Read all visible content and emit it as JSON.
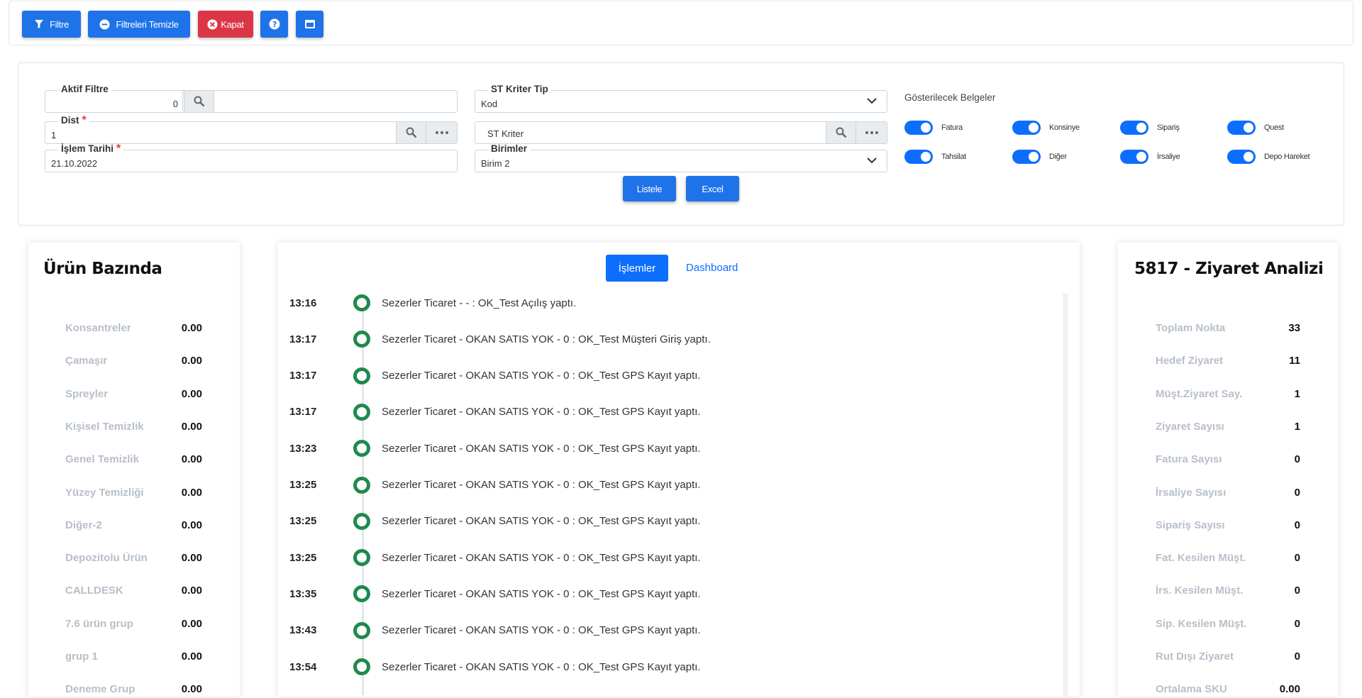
{
  "toolbar": {
    "filter_label": "Filtre",
    "clear_label": "Filtreleri Temizle",
    "close_label": "Kapat"
  },
  "filters": {
    "aktif_filtre": {
      "label": "Aktif Filtre",
      "value": "0"
    },
    "dist": {
      "label": "Dist",
      "value": "1"
    },
    "islem_tarihi": {
      "label": "İşlem Tarihi",
      "value": "21.10.2022"
    },
    "st_kriter_tip": {
      "label": "ST Kriter Tip",
      "value": "Kod"
    },
    "st_kriter": {
      "placeholder": "ST Kriter"
    },
    "birimler": {
      "label": "Birimler",
      "value": "Birim 2"
    },
    "required_mark": "*"
  },
  "documents": {
    "title": "Gösterilecek Belgeler",
    "toggles": [
      {
        "label": "Fatura",
        "on": true
      },
      {
        "label": "Konsinye",
        "on": true
      },
      {
        "label": "Sipariş",
        "on": true
      },
      {
        "label": "Quest",
        "on": true
      },
      {
        "label": "Tahsilat",
        "on": true
      },
      {
        "label": "Diğer",
        "on": true
      },
      {
        "label": "İrsaliye",
        "on": true
      },
      {
        "label": "Depo Hareket",
        "on": true
      }
    ]
  },
  "actions": {
    "list_label": "Listele",
    "excel_label": "Excel"
  },
  "product_card": {
    "title": "Ürün Bazında",
    "rows": [
      {
        "name": "Konsantreler",
        "value": "0.00"
      },
      {
        "name": "Çamaşır",
        "value": "0.00"
      },
      {
        "name": "Spreyler",
        "value": "0.00"
      },
      {
        "name": "Kişisel Temizlik",
        "value": "0.00"
      },
      {
        "name": "Genel Temizlik",
        "value": "0.00"
      },
      {
        "name": "Yüzey Temizliği",
        "value": "0.00"
      },
      {
        "name": "Diğer-2",
        "value": "0.00"
      },
      {
        "name": "Depozitolu Ürün",
        "value": "0.00"
      },
      {
        "name": "CALLDESK",
        "value": "0.00"
      },
      {
        "name": "7.6 ürün grup",
        "value": "0.00"
      },
      {
        "name": "grup 1",
        "value": "0.00"
      },
      {
        "name": "Deneme Grup",
        "value": "0.00"
      }
    ]
  },
  "timeline": {
    "tab_active": "İşlemler",
    "tab_other": "Dashboard",
    "events": [
      {
        "time": "13:16",
        "text": "Sezerler Ticaret - - : OK_Test Açılış yaptı."
      },
      {
        "time": "13:17",
        "text": "Sezerler Ticaret - OKAN SATIS YOK - 0 : OK_Test Müşteri Giriş yaptı."
      },
      {
        "time": "13:17",
        "text": "Sezerler Ticaret - OKAN SATIS YOK - 0 : OK_Test GPS Kayıt yaptı."
      },
      {
        "time": "13:17",
        "text": "Sezerler Ticaret - OKAN SATIS YOK - 0 : OK_Test GPS Kayıt yaptı."
      },
      {
        "time": "13:23",
        "text": "Sezerler Ticaret - OKAN SATIS YOK - 0 : OK_Test GPS Kayıt yaptı."
      },
      {
        "time": "13:25",
        "text": "Sezerler Ticaret - OKAN SATIS YOK - 0 : OK_Test GPS Kayıt yaptı."
      },
      {
        "time": "13:25",
        "text": "Sezerler Ticaret - OKAN SATIS YOK - 0 : OK_Test GPS Kayıt yaptı."
      },
      {
        "time": "13:25",
        "text": "Sezerler Ticaret - OKAN SATIS YOK - 0 : OK_Test GPS Kayıt yaptı."
      },
      {
        "time": "13:35",
        "text": "Sezerler Ticaret - OKAN SATIS YOK - 0 : OK_Test GPS Kayıt yaptı."
      },
      {
        "time": "13:43",
        "text": "Sezerler Ticaret - OKAN SATIS YOK - 0 : OK_Test GPS Kayıt yaptı."
      },
      {
        "time": "13:54",
        "text": "Sezerler Ticaret - OKAN SATIS YOK - 0 : OK_Test GPS Kayıt yaptı."
      }
    ]
  },
  "visit_card": {
    "title": "5817 - Ziyaret Analizi",
    "rows": [
      {
        "name": "Toplam Nokta",
        "value": "33"
      },
      {
        "name": "Hedef Ziyaret",
        "value": "11"
      },
      {
        "name": "Müşt.Ziyaret Say.",
        "value": "1"
      },
      {
        "name": "Ziyaret Sayısı",
        "value": "1"
      },
      {
        "name": "Fatura Sayısı",
        "value": "0"
      },
      {
        "name": "İrsaliye Sayısı",
        "value": "0"
      },
      {
        "name": "Sipariş Sayısı",
        "value": "0"
      },
      {
        "name": "Fat. Kesilen Müşt.",
        "value": "0"
      },
      {
        "name": "İrs. Kesilen Müşt.",
        "value": "0"
      },
      {
        "name": "Sip. Kesilen Müşt.",
        "value": "0"
      },
      {
        "name": "Rut Dışı Ziyaret",
        "value": "0"
      },
      {
        "name": "Ortalama SKU",
        "value": "0.00"
      }
    ]
  },
  "colors": {
    "primary": "#1e73e8",
    "danger": "#dc3545",
    "timeline_dot": "#1e8a4c",
    "muted": "#b7bfc9"
  }
}
